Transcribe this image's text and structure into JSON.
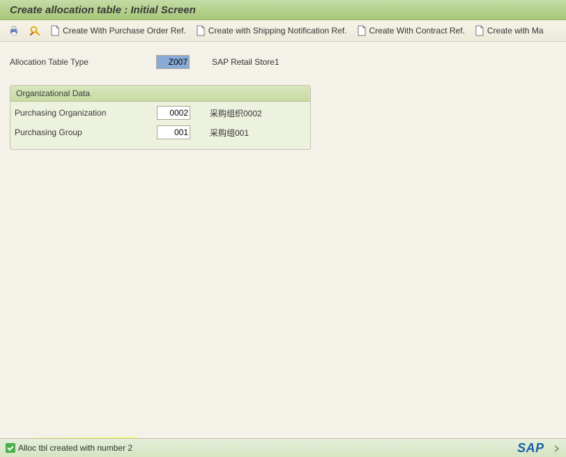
{
  "title": "Create allocation table : Initial Screen",
  "toolbar": {
    "create_po": "Create With Purchase Order Ref.",
    "create_ship": "Create with Shipping Notification Ref.",
    "create_contract": "Create With Contract Ref.",
    "create_ma": "Create with Ma"
  },
  "fields": {
    "alloc_type_label": "Allocation Table Type",
    "alloc_type_value": "Z007",
    "alloc_type_desc": "SAP Retail Store1"
  },
  "org": {
    "header": "Organizational Data",
    "purch_org_label": "Purchasing Organization",
    "purch_org_value": "0002",
    "purch_org_desc": "采购组织0002",
    "purch_grp_label": "Purchasing Group",
    "purch_grp_value": "001",
    "purch_grp_desc": "采购组001"
  },
  "status": {
    "message": "Alloc tbl created with number 2"
  },
  "branding": {
    "logo": "SAP"
  }
}
